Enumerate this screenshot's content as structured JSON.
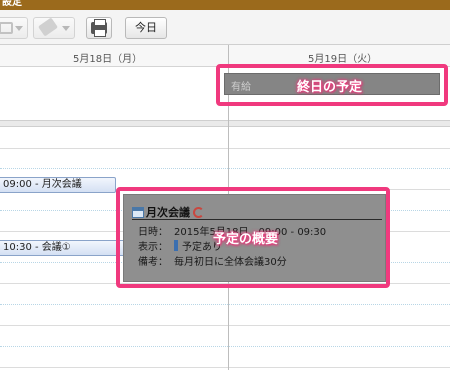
{
  "window": {
    "title": "設定"
  },
  "toolbar": {
    "today_label": "今日"
  },
  "days": [
    {
      "label": "5月18日（月）"
    },
    {
      "label": "5月19日（火）"
    }
  ],
  "allday_event": {
    "label": "有給",
    "color": "#858585"
  },
  "events": [
    {
      "label": "09:00 - 月次会議"
    },
    {
      "label": "10:30 - 会議①"
    }
  ],
  "popup": {
    "title": "月次会議",
    "rows": [
      {
        "key": "日時：",
        "value": "2015年5月18日　09:00 - 09:30"
      },
      {
        "key": "表示：",
        "value": "予定あり"
      },
      {
        "key": "備考：",
        "value": "毎月初日に全体会議30分"
      }
    ]
  },
  "callouts": {
    "allday": "終日の予定",
    "summary": "予定の概要"
  },
  "colors": {
    "titlebar": "#9b6a1c",
    "highlight": "#f0397e",
    "event_border": "#8aa3c9"
  }
}
